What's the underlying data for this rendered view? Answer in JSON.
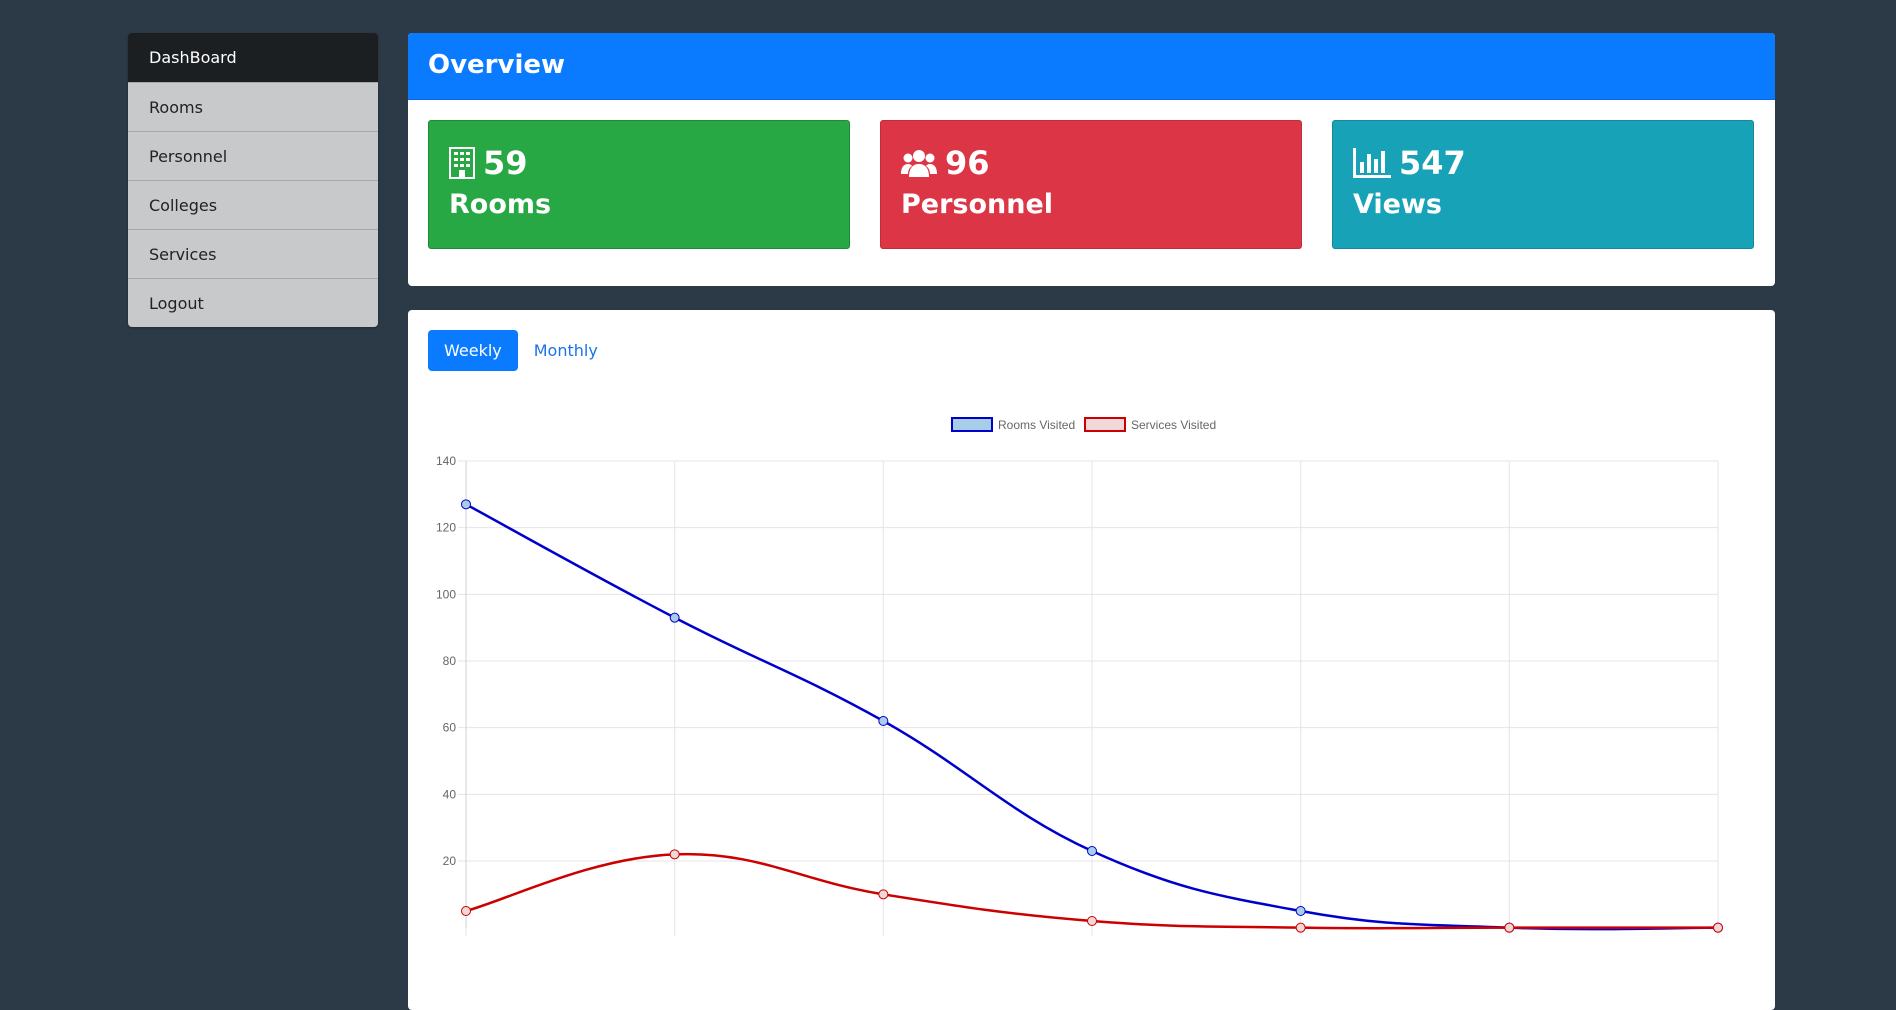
{
  "sidebar": {
    "items": [
      {
        "label": "DashBoard",
        "active": true
      },
      {
        "label": "Rooms"
      },
      {
        "label": "Personnel"
      },
      {
        "label": "Colleges"
      },
      {
        "label": "Services"
      },
      {
        "label": "Logout"
      }
    ]
  },
  "overview": {
    "title": "Overview",
    "cards": [
      {
        "value": "59",
        "label": "Rooms",
        "icon": "building-icon",
        "color": "#28a745"
      },
      {
        "value": "96",
        "label": "Personnel",
        "icon": "users-icon",
        "color": "#dc3545"
      },
      {
        "value": "547",
        "label": "Views",
        "icon": "bar-chart-icon",
        "color": "#17a2b8"
      }
    ]
  },
  "chart_tabs": {
    "weekly": "Weekly",
    "monthly": "Monthly"
  },
  "chart_data": {
    "type": "line",
    "x": [
      1,
      2,
      3,
      4,
      5,
      6,
      7
    ],
    "ylim": [
      0,
      140
    ],
    "yticks": [
      20,
      40,
      60,
      80,
      100,
      120,
      140
    ],
    "grid": true,
    "legend_position": "top",
    "series": [
      {
        "name": "Rooms Visited",
        "color": "#0000cc",
        "fill": "#a7cde8",
        "values": [
          127,
          93,
          62,
          23,
          5,
          0,
          0
        ]
      },
      {
        "name": "Services Visited",
        "color": "#cc0000",
        "fill": "#f0d8d8",
        "values": [
          5,
          22,
          10,
          2,
          0,
          0,
          0
        ]
      }
    ]
  }
}
